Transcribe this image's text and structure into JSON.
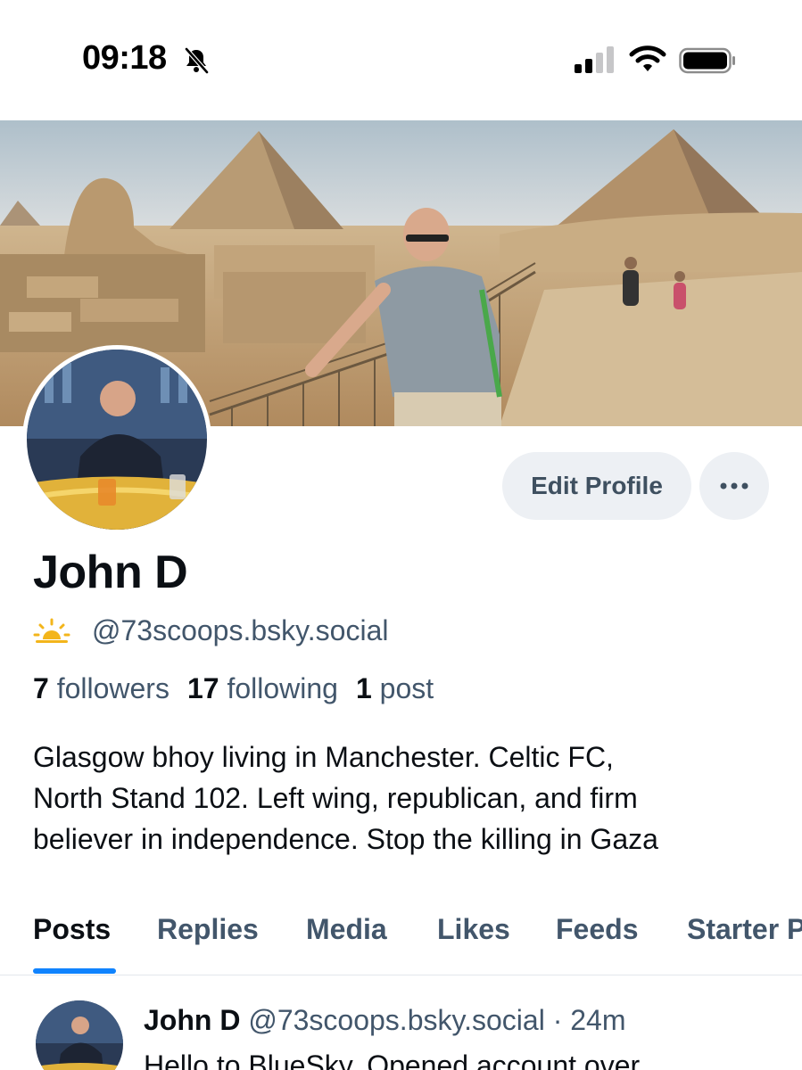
{
  "status_bar": {
    "time": "09:18",
    "icons": [
      "bell-muted-icon",
      "signal-icon",
      "wifi-icon",
      "battery-icon"
    ]
  },
  "profile": {
    "banner": "pyramids-of-giza-photo",
    "avatar": "profile-photo",
    "edit_label": "Edit Profile",
    "more_icon": "ellipsis-icon",
    "display_name": "John D",
    "handle_icon": "sunrise-icon",
    "handle": "@73scoops.bsky.social",
    "followers_count": "7",
    "followers_label": "followers",
    "following_count": "17",
    "following_label": "following",
    "posts_count": "1",
    "posts_label": "post",
    "bio_lines": [
      "Glasgow bhoy living in Manchester. Celtic FC,",
      "North Stand 102. Left wing, republican, and firm",
      "believer in independence. Stop the killing in Gaza"
    ]
  },
  "tabs": [
    {
      "label": "Posts",
      "active": true
    },
    {
      "label": "Replies",
      "active": false
    },
    {
      "label": "Media",
      "active": false
    },
    {
      "label": "Likes",
      "active": false
    },
    {
      "label": "Feeds",
      "active": false
    },
    {
      "label": "Starter Packs",
      "active": false
    }
  ],
  "post": {
    "author_name": "John D",
    "author_handle": "@73scoops.bsky.social",
    "separator": "·",
    "age": "24m",
    "text_start": "Hello to BlueSky. Opened account over"
  },
  "colors": {
    "accent": "#1083fe",
    "secondary_text": "#42566b",
    "button_bg": "#edf0f4"
  }
}
